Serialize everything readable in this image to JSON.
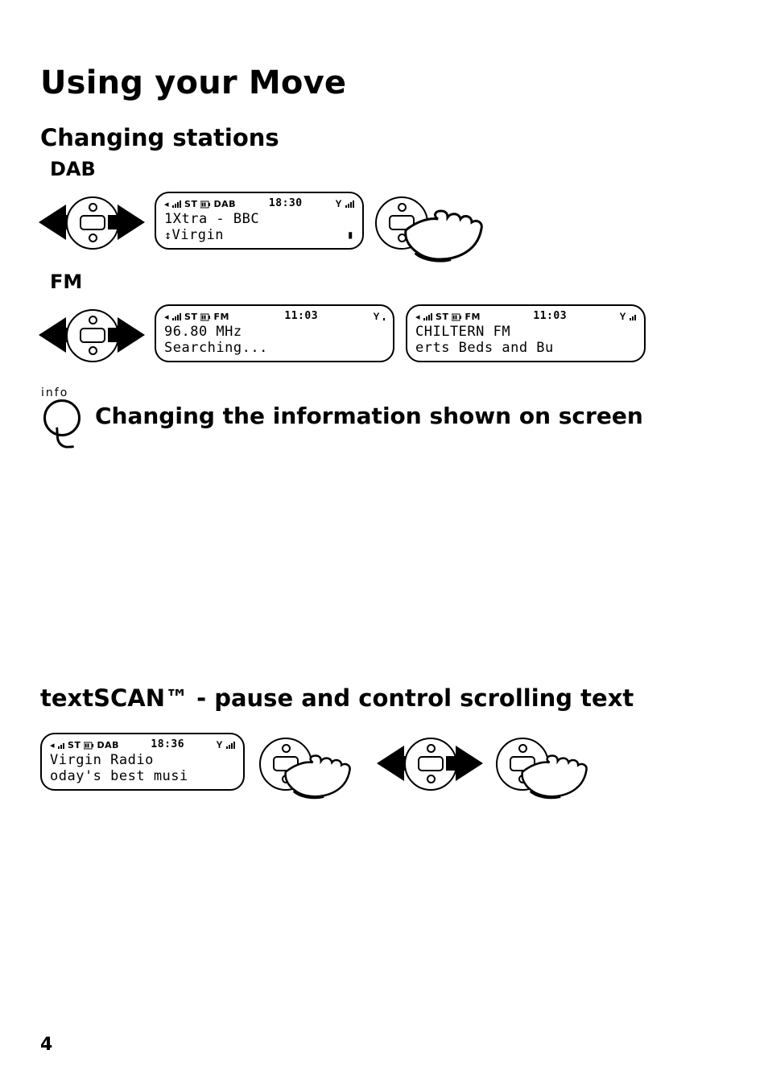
{
  "page_number": "4",
  "title": "Using your Move",
  "section_changing_stations": "Changing stations",
  "mode_dab": "DAB",
  "mode_fm": "FM",
  "info_label": "info",
  "section_info_heading": "Changing the information shown on screen",
  "section_textscan": "textSCAN™ - pause and control scrolling text",
  "lcd": {
    "dab": {
      "status_left": {
        "st": "ST",
        "mode": "DAB"
      },
      "time": "18:30",
      "line1": "1Xtra - BBC",
      "line2": "Virgin",
      "arrow_prefix": "↕"
    },
    "fm_search": {
      "status_left": {
        "st": "ST",
        "mode": "FM"
      },
      "time": "11:03",
      "line1": "96.80 MHz",
      "line2": "Searching..."
    },
    "fm_found": {
      "status_left": {
        "st": "ST",
        "mode": "FM"
      },
      "time": "11:03",
      "line1": "CHILTERN FM",
      "line2": "erts Beds and Bu"
    },
    "textscan": {
      "status_left": {
        "st": "ST",
        "mode": "DAB"
      },
      "time": "18:36",
      "line1": "Virgin Radio",
      "line2": "oday's best musi"
    }
  }
}
